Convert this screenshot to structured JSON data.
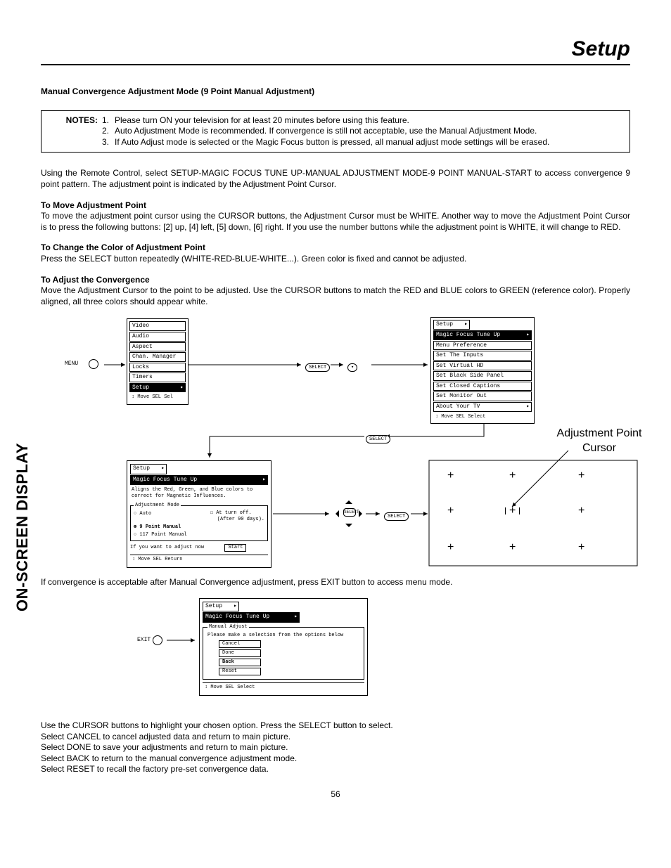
{
  "header": {
    "title": "Setup"
  },
  "section": {
    "main_title": "Manual Convergence Adjustment Mode (9 Point Manual Adjustment)",
    "notes_label": "NOTES:",
    "notes": [
      "Please turn ON your television for at least 20 minutes before using this feature.",
      "Auto Adjustment Mode is recommended.  If convergence is still not acceptable, use the Manual Adjustment Mode.",
      "If Auto Adjust mode is selected or the Magic Focus button is pressed, all manual adjust mode settings will be erased."
    ],
    "intro": "Using the Remote Control, select SETUP-MAGIC FOCUS TUNE UP-MANUAL ADJUSTMENT MODE-9 POINT MANUAL-START to access convergence 9 point  pattern.  The adjustment point is indicated by the Adjustment Point Cursor.",
    "move_title": "To Move Adjustment Point",
    "move_text": "To move the adjustment point cursor using the CURSOR buttons, the Adjustment Cursor must be WHITE.  Another way to move the Adjustment Point Cursor is to press the following buttons:  [2] up, [4] left, [5] down, [6] right.  If you use the number buttons while the adjustment point is WHITE, it will change to RED.",
    "color_title": "To Change the Color of Adjustment Point",
    "color_text": "Press the SELECT button repeatedly (WHITE-RED-BLUE-WHITE...).  Green color is fixed and cannot be adjusted.",
    "adjust_title": "To Adjust the Convergence",
    "adjust_text": "Move the Adjustment Cursor to the point to be adjusted.  Use the CURSOR buttons to match the RED and BLUE colors to GREEN (reference color).  Properly aligned, all three colors should appear white.",
    "after_text": "If convergence is acceptable after Manual Convergence adjustment, press EXIT button to access menu mode.",
    "tail": [
      "Use the CURSOR buttons to highlight your chosen option.  Press the SELECT button to select.",
      "Select CANCEL to cancel adjusted data and return to main picture.",
      "Select DONE to save your adjustments and return to main picture.",
      "Select BACK to return to the manual convergence adjustment mode.",
      "Select RESET to recall the factory pre-set convergence data."
    ]
  },
  "labels": {
    "menu": "MENU",
    "select": "SELECT",
    "exit": "EXIT",
    "sel_small": "SEL",
    "move": "Move",
    "return": "Return",
    "select2": "Select",
    "start": "Start"
  },
  "menu1": {
    "items": [
      "Video",
      "Audio",
      "Aspect",
      "Chan. Manager",
      "Locks",
      "Timers",
      "Setup"
    ],
    "highlight": "Setup",
    "foot": "Move  SEL  Sel"
  },
  "menu2": {
    "title": "Setup",
    "items": [
      "Magic Focus Tune Up",
      "Menu Preference",
      "Set The Inputs",
      "Set Virtual HD",
      "Set Black Side Panel",
      "Set Closed Captions",
      "Set Monitor Out",
      "About Your TV"
    ],
    "highlight": "Magic Focus Tune Up",
    "foot": "Move  SEL  Select"
  },
  "menu3": {
    "title": "Setup",
    "sub": "Magic Focus Tune Up",
    "desc": "Aligns the Red, Green, and Blue colors to correct for Magnetic Influences.",
    "legend": "Adjustment Mode",
    "auto": "Auto",
    "atturn": "At turn off.",
    "atturn2": "(After 90 days).",
    "nine": "9 Point Manual",
    "p117": "117 Point Manual",
    "ifadjust": "If you want to adjust now",
    "foot": "Move  SEL  Return"
  },
  "adjbox": {
    "label1": "Adjustment Point",
    "label2": "Cursor"
  },
  "menu4": {
    "title": "Setup",
    "sub": "Magic Focus Tune Up",
    "legend": "Manual Adjust",
    "prompt": "Please make a selection from the options below",
    "opts": [
      "Cancel",
      "Done",
      "Back",
      "Reset"
    ],
    "highlight": "Back",
    "foot": "Move  SEL  Select"
  },
  "side": "ON-SCREEN DISPLAY",
  "page": "56"
}
